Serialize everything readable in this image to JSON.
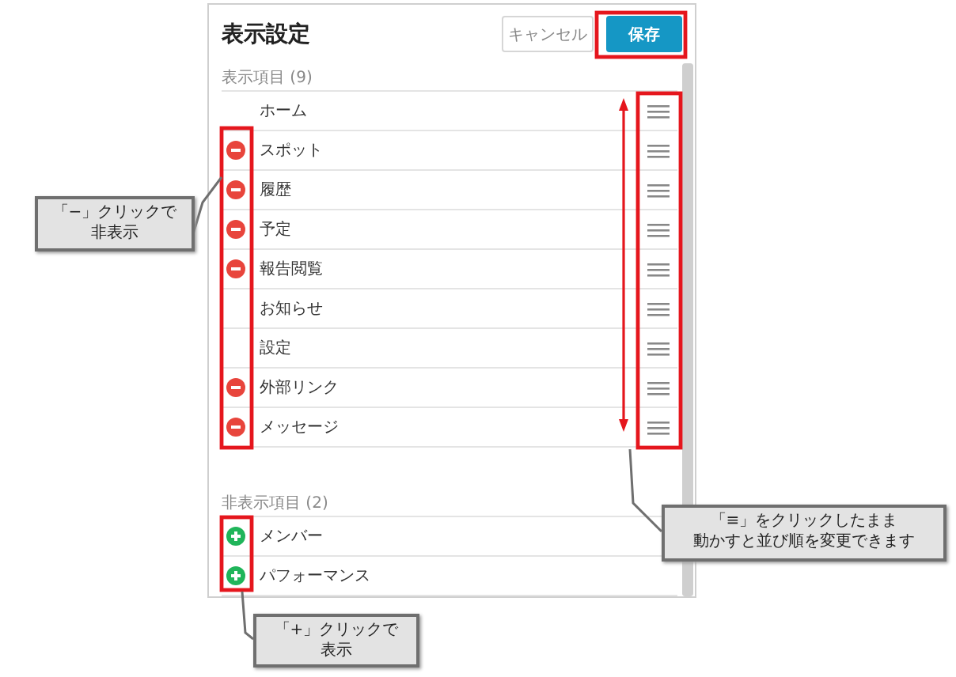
{
  "panel": {
    "title": "表示設定",
    "buttons": [
      {
        "kind": "secondary",
        "label": "キャンセル"
      },
      {
        "kind": "primary",
        "label": "保存"
      }
    ]
  },
  "visible_section": {
    "label": "表示項目 (9)",
    "items": [
      {
        "label": "ホーム",
        "removable": false
      },
      {
        "label": "スポット",
        "removable": true
      },
      {
        "label": "履歴",
        "removable": true
      },
      {
        "label": "予定",
        "removable": true
      },
      {
        "label": "報告閲覧",
        "removable": true
      },
      {
        "label": "お知らせ",
        "removable": false
      },
      {
        "label": "設定",
        "removable": false
      },
      {
        "label": "外部リンク",
        "removable": true
      },
      {
        "label": "メッセージ",
        "removable": true
      }
    ]
  },
  "hidden_section": {
    "label": "非表示項目 (2)",
    "items": [
      {
        "label": "メンバー"
      },
      {
        "label": "パフォーマンス"
      }
    ]
  },
  "callouts": [
    {
      "lines": [
        "「−」クリックで",
        "非表示"
      ]
    },
    {
      "lines": [
        "「≡」をクリックしたまま",
        "動かすと並び順を変更できます"
      ]
    },
    {
      "lines": [
        "「+」クリックで",
        "表示"
      ]
    }
  ]
}
